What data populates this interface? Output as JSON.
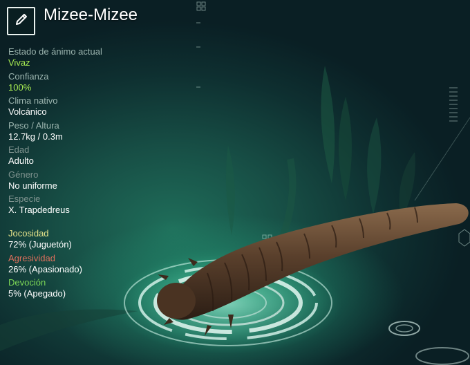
{
  "creature": {
    "name": "Mizee-Mizee"
  },
  "stats": [
    {
      "label": "Estado de ánimo actual",
      "value": "Vivaz"
    },
    {
      "label": "Confianza",
      "value": "100%"
    },
    {
      "label": "Clima nativo",
      "value": "Volcánico"
    },
    {
      "label": "Peso / Altura",
      "value": "12.7kg / 0.3m"
    },
    {
      "label": "Edad",
      "value": "Adulto"
    },
    {
      "label": "Género",
      "value": "No uniforme"
    },
    {
      "label": "Especie",
      "value": "X. Trapdedreus"
    }
  ],
  "personality": [
    {
      "label": "Jocosidad",
      "value": "72% (Juguetón)"
    },
    {
      "label": "Agresividad",
      "value": "26% (Apasionado)"
    },
    {
      "label": "Devoción",
      "value": "5% (Apegado)"
    }
  ],
  "icons": {
    "edit": "pencil-icon"
  },
  "colors": {
    "highlight_value": "#a8ec52",
    "joy": "#e6e38a",
    "aggression": "#e0705c",
    "devotion": "#7ed957"
  }
}
